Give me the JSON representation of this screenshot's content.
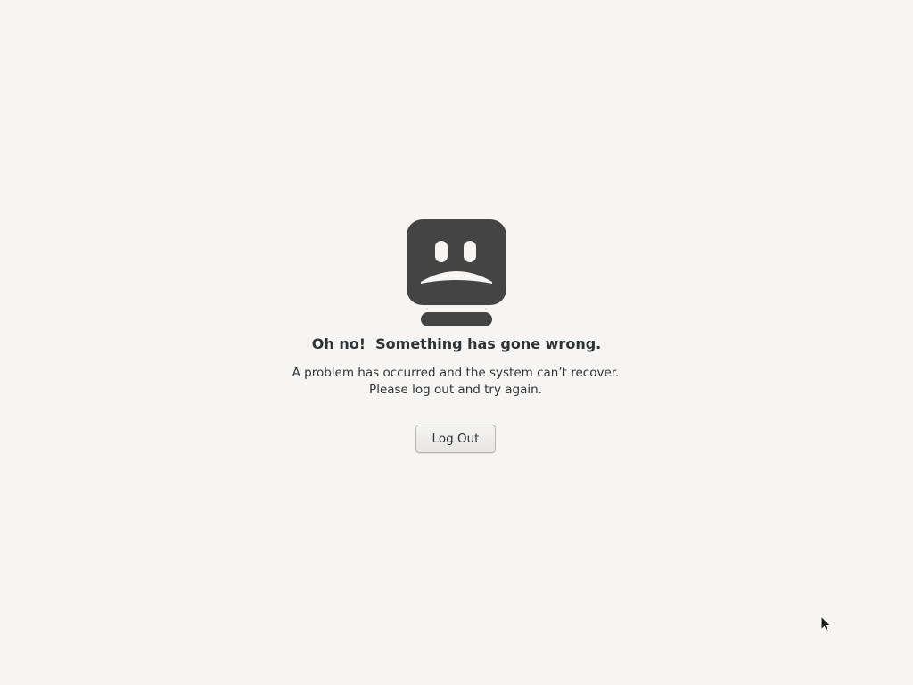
{
  "error_screen": {
    "title": "Oh no!  Something has gone wrong.",
    "message_line_1": "A problem has occurred and the system can’t recover.",
    "message_line_2": "Please log out and try again.",
    "logout_button_label": "Log Out",
    "icon": "computer-fail-icon"
  },
  "colors": {
    "background": "#f6f5f4",
    "icon": "#444444",
    "text": "#2e3436"
  }
}
